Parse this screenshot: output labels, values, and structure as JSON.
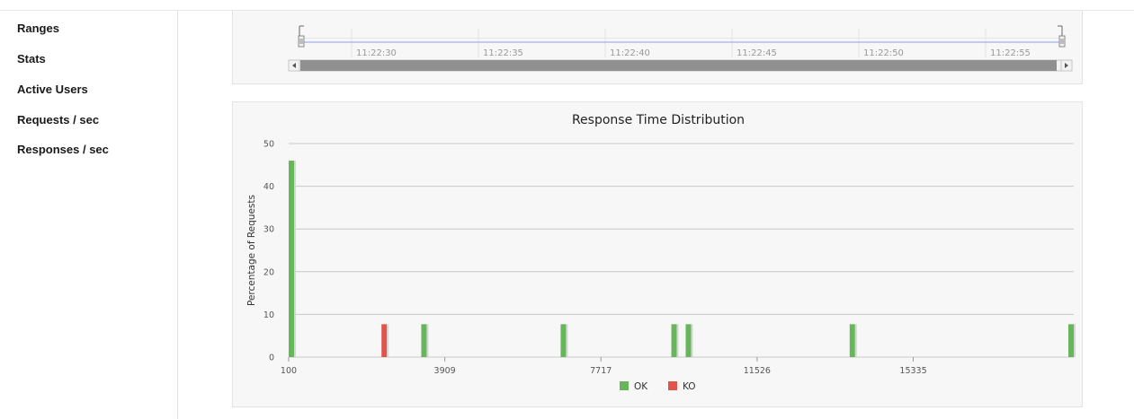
{
  "sidebar": {
    "items": [
      {
        "label": "Ranges"
      },
      {
        "label": "Stats"
      },
      {
        "label": "Active Users"
      },
      {
        "label": "Requests / sec"
      },
      {
        "label": "Responses / sec"
      }
    ]
  },
  "navigator": {
    "time_labels": [
      "11:22:30",
      "11:22:35",
      "11:22:40",
      "11:22:45",
      "11:22:50",
      "11:22:55"
    ],
    "series_color": "#8f9ee8"
  },
  "colors": {
    "ok": "#68b65c",
    "ko": "#e0544c",
    "grid": "#c8c8c8",
    "panel_bg": "#f7f7f7"
  },
  "chart_data": {
    "type": "bar",
    "title": "Response Time Distribution",
    "xlabel": "",
    "ylabel": "Percentage of Requests",
    "xlim": [
      100,
      19250
    ],
    "ylim": [
      0,
      50
    ],
    "x_ticks": [
      100,
      3909,
      7717,
      11526,
      15335
    ],
    "y_ticks": [
      0,
      10,
      20,
      30,
      40,
      50
    ],
    "grid": true,
    "legend_position": "bottom",
    "series": [
      {
        "name": "OK",
        "color": "#68b65c",
        "points": [
          [
            100,
            46
          ],
          [
            3400,
            7.7
          ],
          [
            6800,
            7.7
          ],
          [
            9500,
            7.7
          ],
          [
            9850,
            7.7
          ],
          [
            13850,
            7.7
          ],
          [
            19200,
            7.7
          ]
        ]
      },
      {
        "name": "KO",
        "color": "#e0544c",
        "points": [
          [
            2430,
            7.7
          ]
        ]
      }
    ]
  }
}
